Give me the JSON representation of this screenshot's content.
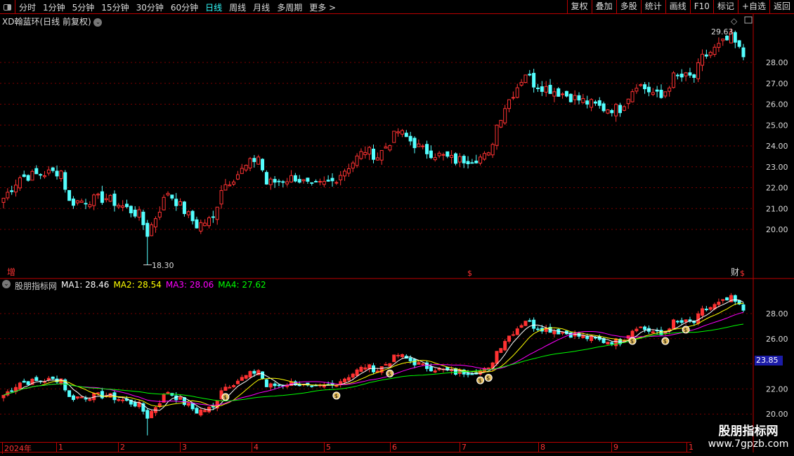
{
  "toolbar": {
    "periods": [
      "分时",
      "1分钟",
      "5分钟",
      "15分钟",
      "30分钟",
      "60分钟",
      "日线",
      "周线",
      "月线",
      "多周期",
      "更多 >"
    ],
    "active_period": "日线",
    "right_buttons": [
      "复权",
      "叠加",
      "多股",
      "统计",
      "画线",
      "F10",
      "标记",
      "+自选",
      "返回"
    ]
  },
  "main_title": "XD翰蓝环(日线 前复权)",
  "upper_axis": [
    "28.00",
    "27.00",
    "26.00",
    "25.00",
    "24.00",
    "23.00",
    "22.00",
    "21.00",
    "20.00"
  ],
  "high_label": "29.63",
  "low_label": "18.30",
  "markers": {
    "left": "增",
    "mid": "$",
    "right": "财",
    "right2": "$"
  },
  "indicator": {
    "name": "股朋指标网",
    "ma": [
      {
        "label": "MA1: 28.46",
        "color": "#ffffff"
      },
      {
        "label": "MA2: 28.54",
        "color": "#ffff00"
      },
      {
        "label": "MA3: 28.06",
        "color": "#ff00ff"
      },
      {
        "label": "MA4: 27.62",
        "color": "#00ff00"
      }
    ]
  },
  "lower_axis": [
    "28.00",
    "26.00",
    "22.00",
    "20.00"
  ],
  "current_price": "23.85",
  "months": [
    "2024年",
    "1",
    "2",
    "3",
    "4",
    "5",
    "6",
    "7",
    "8",
    "9",
    "1"
  ],
  "watermark": {
    "line1": "股朋指标网",
    "line2": "www.7gpzb.com"
  },
  "colors": {
    "up": "#ff3232",
    "down": "#54ffff",
    "grid": "#7a0000"
  },
  "chart_data": {
    "type": "candlestick",
    "count": 181,
    "price_path": [
      [
        0,
        21.5
      ],
      [
        4,
        22.5
      ],
      [
        14,
        22.8
      ],
      [
        16,
        21.3
      ],
      [
        25,
        21.5
      ],
      [
        33,
        20.7
      ],
      [
        35,
        19.8
      ],
      [
        40,
        21.8
      ],
      [
        47,
        20.2
      ],
      [
        51,
        20.5
      ],
      [
        53,
        22.0
      ],
      [
        62,
        23.5
      ],
      [
        64,
        22.2
      ],
      [
        71,
        22.5
      ],
      [
        75,
        22.0
      ],
      [
        80,
        22.3
      ],
      [
        88,
        23.8
      ],
      [
        91,
        23.5
      ],
      [
        96,
        24.7
      ],
      [
        102,
        23.8
      ],
      [
        110,
        23.3
      ],
      [
        118,
        23.5
      ],
      [
        120,
        25.0
      ],
      [
        122,
        25.9
      ],
      [
        127,
        27.5
      ],
      [
        129,
        27.0
      ],
      [
        136,
        26.5
      ],
      [
        146,
        25.8
      ],
      [
        150,
        25.8
      ],
      [
        154,
        27.0
      ],
      [
        160,
        26.3
      ],
      [
        163,
        27.3
      ],
      [
        168,
        27.3
      ],
      [
        170,
        28.2
      ],
      [
        177,
        29.2
      ],
      [
        180,
        28.3
      ]
    ],
    "high": 29.63,
    "low": 18.3,
    "signals": [
      54,
      81,
      94,
      116,
      118,
      153,
      161,
      166
    ]
  }
}
